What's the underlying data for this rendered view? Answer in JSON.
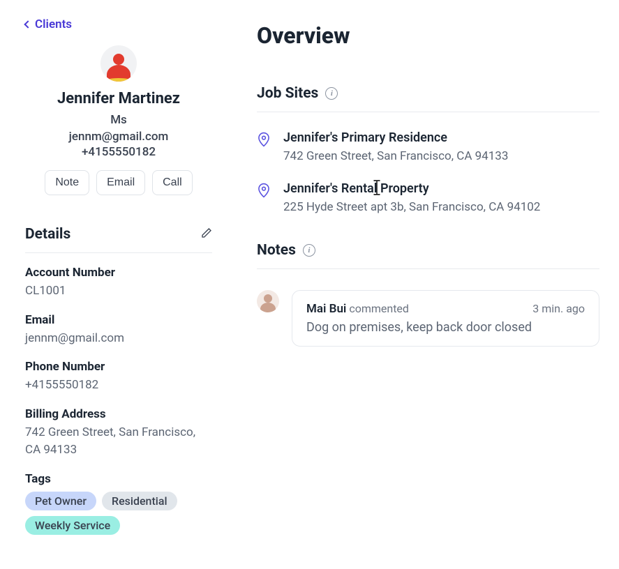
{
  "back": {
    "label": "Clients"
  },
  "client": {
    "name": "Jennifer Martinez",
    "title": "Ms",
    "email": "jennm@gmail.com",
    "phone": "+4155550182"
  },
  "actions": {
    "note": "Note",
    "email": "Email",
    "call": "Call"
  },
  "details": {
    "heading": "Details",
    "account_label": "Account Number",
    "account_value": "CL1001",
    "email_label": "Email",
    "email_value": "jennm@gmail.com",
    "phone_label": "Phone Number",
    "phone_value": "+4155550182",
    "billing_label": "Billing Address",
    "billing_value": "742 Green Street, San Francisco, CA 94133",
    "tags_label": "Tags",
    "tags": [
      "Pet Owner",
      "Residential",
      "Weekly Service"
    ]
  },
  "overview": {
    "title": "Overview"
  },
  "job_sites": {
    "heading": "Job Sites",
    "items": [
      {
        "name": "Jennifer's Primary Residence",
        "address": "742 Green Street, San Francisco, CA 94133"
      },
      {
        "name": "Jennifer's Rental Property",
        "address": "225 Hyde Street apt 3b, San Francisco, CA 94102"
      }
    ]
  },
  "notes": {
    "heading": "Notes",
    "items": [
      {
        "author": "Mai Bui",
        "action": "commented",
        "time": "3 min. ago",
        "body": "Dog on premises, keep back door closed"
      }
    ]
  }
}
